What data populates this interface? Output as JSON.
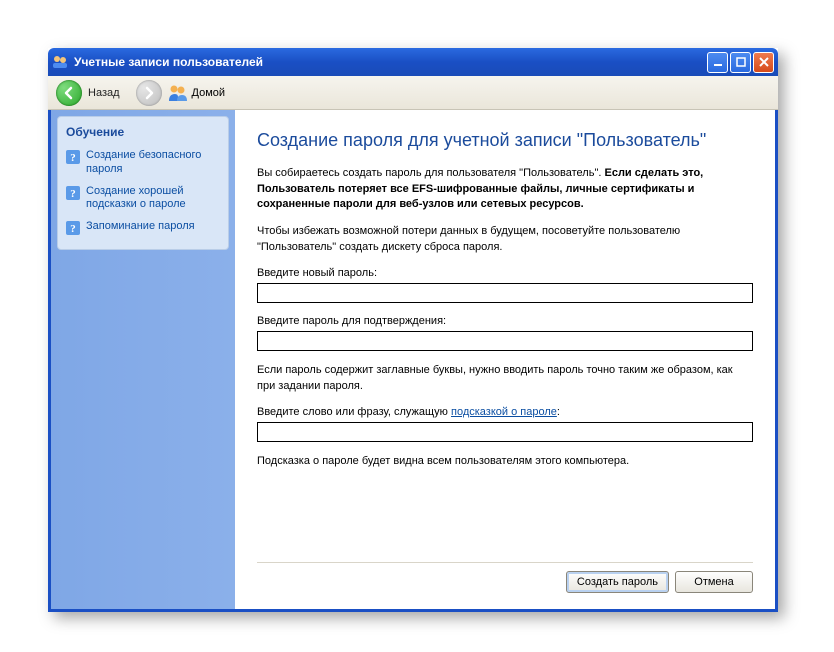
{
  "window": {
    "title": "Учетные записи пользователей"
  },
  "toolbar": {
    "back_label": "Назад",
    "home_label": "Домой"
  },
  "sidebar": {
    "title": "Обучение",
    "links": [
      "Создание безопасного пароля",
      "Создание хорошей подсказки о пароле",
      "Запоминание пароля"
    ]
  },
  "main": {
    "heading": "Создание пароля для учетной записи \"Пользователь\"",
    "warning_prefix": "Вы собираетесь создать пароль для пользователя \"Пользователь\". ",
    "warning_bold": "Если сделать это, Пользователь потеряет все EFS-шифрованные файлы, личные сертификаты и сохраненные пароли для веб-узлов или сетевых ресурсов.",
    "advice": "Чтобы избежать возможной потери данных в будущем, посоветуйте пользователю \"Пользователь\" создать дискету сброса пароля.",
    "label_new_password": "Введите новый пароль:",
    "label_confirm_password": "Введите пароль для подтверждения:",
    "caps_note": "Если пароль содержит заглавные буквы, нужно вводить пароль точно таким же образом, как при задании пароля.",
    "label_hint_prefix": "Введите слово или фразу, служащую ",
    "label_hint_link": "подсказкой о пароле",
    "label_hint_suffix": ":",
    "hint_visible_note": "Подсказка о пароле будет видна всем пользователям этого компьютера."
  },
  "buttons": {
    "create": "Создать пароль",
    "cancel": "Отмена"
  }
}
